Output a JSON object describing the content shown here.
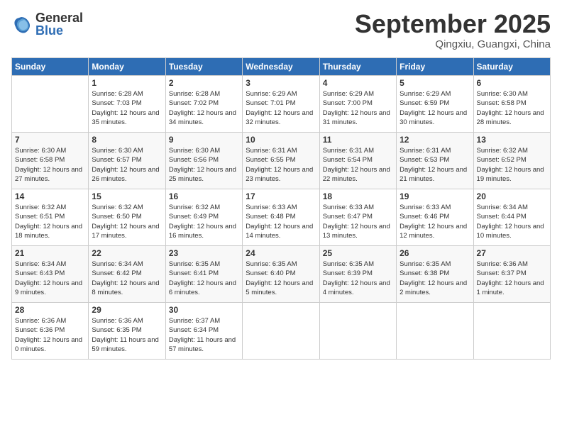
{
  "logo": {
    "general": "General",
    "blue": "Blue"
  },
  "title": "September 2025",
  "location": "Qingxiu, Guangxi, China",
  "headers": [
    "Sunday",
    "Monday",
    "Tuesday",
    "Wednesday",
    "Thursday",
    "Friday",
    "Saturday"
  ],
  "weeks": [
    [
      {
        "day": "",
        "sunrise": "",
        "sunset": "",
        "daylight": ""
      },
      {
        "day": "1",
        "sunrise": "Sunrise: 6:28 AM",
        "sunset": "Sunset: 7:03 PM",
        "daylight": "Daylight: 12 hours and 35 minutes."
      },
      {
        "day": "2",
        "sunrise": "Sunrise: 6:28 AM",
        "sunset": "Sunset: 7:02 PM",
        "daylight": "Daylight: 12 hours and 34 minutes."
      },
      {
        "day": "3",
        "sunrise": "Sunrise: 6:29 AM",
        "sunset": "Sunset: 7:01 PM",
        "daylight": "Daylight: 12 hours and 32 minutes."
      },
      {
        "day": "4",
        "sunrise": "Sunrise: 6:29 AM",
        "sunset": "Sunset: 7:00 PM",
        "daylight": "Daylight: 12 hours and 31 minutes."
      },
      {
        "day": "5",
        "sunrise": "Sunrise: 6:29 AM",
        "sunset": "Sunset: 6:59 PM",
        "daylight": "Daylight: 12 hours and 30 minutes."
      },
      {
        "day": "6",
        "sunrise": "Sunrise: 6:30 AM",
        "sunset": "Sunset: 6:58 PM",
        "daylight": "Daylight: 12 hours and 28 minutes."
      }
    ],
    [
      {
        "day": "7",
        "sunrise": "Sunrise: 6:30 AM",
        "sunset": "Sunset: 6:58 PM",
        "daylight": "Daylight: 12 hours and 27 minutes."
      },
      {
        "day": "8",
        "sunrise": "Sunrise: 6:30 AM",
        "sunset": "Sunset: 6:57 PM",
        "daylight": "Daylight: 12 hours and 26 minutes."
      },
      {
        "day": "9",
        "sunrise": "Sunrise: 6:30 AM",
        "sunset": "Sunset: 6:56 PM",
        "daylight": "Daylight: 12 hours and 25 minutes."
      },
      {
        "day": "10",
        "sunrise": "Sunrise: 6:31 AM",
        "sunset": "Sunset: 6:55 PM",
        "daylight": "Daylight: 12 hours and 23 minutes."
      },
      {
        "day": "11",
        "sunrise": "Sunrise: 6:31 AM",
        "sunset": "Sunset: 6:54 PM",
        "daylight": "Daylight: 12 hours and 22 minutes."
      },
      {
        "day": "12",
        "sunrise": "Sunrise: 6:31 AM",
        "sunset": "Sunset: 6:53 PM",
        "daylight": "Daylight: 12 hours and 21 minutes."
      },
      {
        "day": "13",
        "sunrise": "Sunrise: 6:32 AM",
        "sunset": "Sunset: 6:52 PM",
        "daylight": "Daylight: 12 hours and 19 minutes."
      }
    ],
    [
      {
        "day": "14",
        "sunrise": "Sunrise: 6:32 AM",
        "sunset": "Sunset: 6:51 PM",
        "daylight": "Daylight: 12 hours and 18 minutes."
      },
      {
        "day": "15",
        "sunrise": "Sunrise: 6:32 AM",
        "sunset": "Sunset: 6:50 PM",
        "daylight": "Daylight: 12 hours and 17 minutes."
      },
      {
        "day": "16",
        "sunrise": "Sunrise: 6:32 AM",
        "sunset": "Sunset: 6:49 PM",
        "daylight": "Daylight: 12 hours and 16 minutes."
      },
      {
        "day": "17",
        "sunrise": "Sunrise: 6:33 AM",
        "sunset": "Sunset: 6:48 PM",
        "daylight": "Daylight: 12 hours and 14 minutes."
      },
      {
        "day": "18",
        "sunrise": "Sunrise: 6:33 AM",
        "sunset": "Sunset: 6:47 PM",
        "daylight": "Daylight: 12 hours and 13 minutes."
      },
      {
        "day": "19",
        "sunrise": "Sunrise: 6:33 AM",
        "sunset": "Sunset: 6:46 PM",
        "daylight": "Daylight: 12 hours and 12 minutes."
      },
      {
        "day": "20",
        "sunrise": "Sunrise: 6:34 AM",
        "sunset": "Sunset: 6:44 PM",
        "daylight": "Daylight: 12 hours and 10 minutes."
      }
    ],
    [
      {
        "day": "21",
        "sunrise": "Sunrise: 6:34 AM",
        "sunset": "Sunset: 6:43 PM",
        "daylight": "Daylight: 12 hours and 9 minutes."
      },
      {
        "day": "22",
        "sunrise": "Sunrise: 6:34 AM",
        "sunset": "Sunset: 6:42 PM",
        "daylight": "Daylight: 12 hours and 8 minutes."
      },
      {
        "day": "23",
        "sunrise": "Sunrise: 6:35 AM",
        "sunset": "Sunset: 6:41 PM",
        "daylight": "Daylight: 12 hours and 6 minutes."
      },
      {
        "day": "24",
        "sunrise": "Sunrise: 6:35 AM",
        "sunset": "Sunset: 6:40 PM",
        "daylight": "Daylight: 12 hours and 5 minutes."
      },
      {
        "day": "25",
        "sunrise": "Sunrise: 6:35 AM",
        "sunset": "Sunset: 6:39 PM",
        "daylight": "Daylight: 12 hours and 4 minutes."
      },
      {
        "day": "26",
        "sunrise": "Sunrise: 6:35 AM",
        "sunset": "Sunset: 6:38 PM",
        "daylight": "Daylight: 12 hours and 2 minutes."
      },
      {
        "day": "27",
        "sunrise": "Sunrise: 6:36 AM",
        "sunset": "Sunset: 6:37 PM",
        "daylight": "Daylight: 12 hours and 1 minute."
      }
    ],
    [
      {
        "day": "28",
        "sunrise": "Sunrise: 6:36 AM",
        "sunset": "Sunset: 6:36 PM",
        "daylight": "Daylight: 12 hours and 0 minutes."
      },
      {
        "day": "29",
        "sunrise": "Sunrise: 6:36 AM",
        "sunset": "Sunset: 6:35 PM",
        "daylight": "Daylight: 11 hours and 59 minutes."
      },
      {
        "day": "30",
        "sunrise": "Sunrise: 6:37 AM",
        "sunset": "Sunset: 6:34 PM",
        "daylight": "Daylight: 11 hours and 57 minutes."
      },
      {
        "day": "",
        "sunrise": "",
        "sunset": "",
        "daylight": ""
      },
      {
        "day": "",
        "sunrise": "",
        "sunset": "",
        "daylight": ""
      },
      {
        "day": "",
        "sunrise": "",
        "sunset": "",
        "daylight": ""
      },
      {
        "day": "",
        "sunrise": "",
        "sunset": "",
        "daylight": ""
      }
    ]
  ]
}
